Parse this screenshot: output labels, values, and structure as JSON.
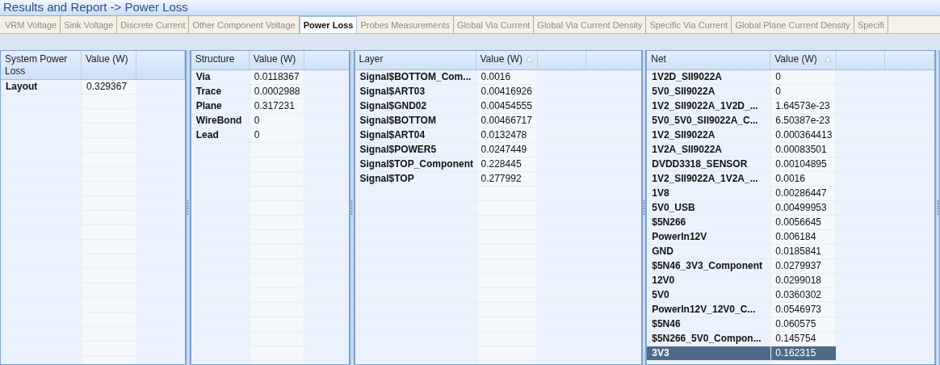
{
  "window": {
    "title": "Results and Report -> Power Loss"
  },
  "tabs": [
    {
      "label": "VRM Voltage",
      "selected": false
    },
    {
      "label": "Sink Voltage",
      "selected": false
    },
    {
      "label": "Discrete Current",
      "selected": false
    },
    {
      "label": "Other Component Voltage",
      "selected": false
    },
    {
      "label": "Power Loss",
      "selected": true
    },
    {
      "label": "Probes Measurements",
      "selected": false
    },
    {
      "label": "Global Via Current",
      "selected": false
    },
    {
      "label": "Global Via Current Density",
      "selected": false
    },
    {
      "label": "Specific Via Current",
      "selected": false
    },
    {
      "label": "Global Plane Current Density",
      "selected": false
    },
    {
      "label": "Specifi",
      "selected": false
    }
  ],
  "tables": [
    {
      "columns": [
        {
          "label": "System Power Loss",
          "sorted": false
        },
        {
          "label": "Value (W)",
          "sorted": false
        }
      ],
      "rows": [
        {
          "cells": [
            "Layout",
            "0.329367"
          ],
          "selected": false
        }
      ]
    },
    {
      "columns": [
        {
          "label": "Structure",
          "sorted": false
        },
        {
          "label": "Value (W)",
          "sorted": false
        }
      ],
      "rows": [
        {
          "cells": [
            "Via",
            "0.0118367"
          ],
          "selected": false
        },
        {
          "cells": [
            "Trace",
            "0.0002988"
          ],
          "selected": false
        },
        {
          "cells": [
            "Plane",
            "0.317231"
          ],
          "selected": false
        },
        {
          "cells": [
            "WireBond",
            "0"
          ],
          "selected": false
        },
        {
          "cells": [
            "Lead",
            "0"
          ],
          "selected": false
        }
      ]
    },
    {
      "columns": [
        {
          "label": "Layer",
          "sorted": false
        },
        {
          "label": "Value (W)",
          "sorted": true
        }
      ],
      "rows": [
        {
          "cells": [
            "Signal$BOTTOM_Com...",
            "0.0016"
          ],
          "selected": false
        },
        {
          "cells": [
            "Signal$ART03",
            "0.00416926"
          ],
          "selected": false
        },
        {
          "cells": [
            "Signal$GND02",
            "0.00454555"
          ],
          "selected": false
        },
        {
          "cells": [
            "Signal$BOTTOM",
            "0.00466717"
          ],
          "selected": false
        },
        {
          "cells": [
            "Signal$ART04",
            "0.0132478"
          ],
          "selected": false
        },
        {
          "cells": [
            "Signal$POWER5",
            "0.0247449"
          ],
          "selected": false
        },
        {
          "cells": [
            "Signal$TOP_Component",
            "0.228445"
          ],
          "selected": false
        },
        {
          "cells": [
            "Signal$TOP",
            "0.277992"
          ],
          "selected": false
        }
      ]
    },
    {
      "columns": [
        {
          "label": "Net",
          "sorted": false
        },
        {
          "label": "Value (W)",
          "sorted": true
        }
      ],
      "rows": [
        {
          "cells": [
            "1V2D_SII9022A",
            "0"
          ],
          "selected": false
        },
        {
          "cells": [
            "5V0_SII9022A",
            "0"
          ],
          "selected": false
        },
        {
          "cells": [
            "1V2_SII9022A_1V2D_...",
            "1.64573e-23"
          ],
          "selected": false
        },
        {
          "cells": [
            "5V0_5V0_SII9022A_C...",
            "6.50387e-23"
          ],
          "selected": false
        },
        {
          "cells": [
            "1V2_SII9022A",
            "0.000364413"
          ],
          "selected": false
        },
        {
          "cells": [
            "1V2A_SII9022A",
            "0.00083501"
          ],
          "selected": false
        },
        {
          "cells": [
            "DVDD3318_SENSOR",
            "0.00104895"
          ],
          "selected": false
        },
        {
          "cells": [
            "1V2_SII9022A_1V2A_...",
            "0.0016"
          ],
          "selected": false
        },
        {
          "cells": [
            "1V8",
            "0.00286447"
          ],
          "selected": false
        },
        {
          "cells": [
            "5V0_USB",
            "0.00499953"
          ],
          "selected": false
        },
        {
          "cells": [
            "$5N266",
            "0.0056645"
          ],
          "selected": false
        },
        {
          "cells": [
            "PowerIn12V",
            "0.006184"
          ],
          "selected": false
        },
        {
          "cells": [
            "GND",
            "0.0185841"
          ],
          "selected": false
        },
        {
          "cells": [
            "$5N46_3V3_Component",
            "0.0279937"
          ],
          "selected": false
        },
        {
          "cells": [
            "12V0",
            "0.0299018"
          ],
          "selected": false
        },
        {
          "cells": [
            "5V0",
            "0.0360302"
          ],
          "selected": false
        },
        {
          "cells": [
            "PowerIn12V_12V0_C...",
            "0.0546973"
          ],
          "selected": false
        },
        {
          "cells": [
            "$5N46",
            "0.060575"
          ],
          "selected": false
        },
        {
          "cells": [
            "$5N266_5V0_Compon...",
            "0.145754"
          ],
          "selected": false
        },
        {
          "cells": [
            "3V3",
            "0.162315"
          ],
          "selected": true
        }
      ]
    }
  ]
}
